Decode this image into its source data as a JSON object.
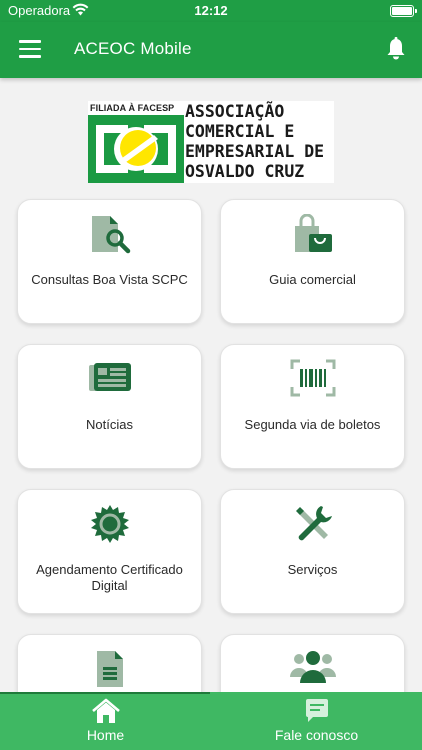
{
  "status_bar": {
    "carrier": "Operadora",
    "time": "12:12"
  },
  "app_bar": {
    "title": "ACEOC Mobile"
  },
  "logo": {
    "tag": "FILIADA À FACESP",
    "lines": [
      "ASSOCIAÇÃO",
      "COMERCIAL E",
      "EMPRESARIAL DE",
      "OSVALDO CRUZ"
    ]
  },
  "menu": [
    {
      "label": "Consultas Boa Vista SCPC",
      "icon": "document-search-icon"
    },
    {
      "label": "Guia comercial",
      "icon": "shopping-bag-icon"
    },
    {
      "label": "Notícias",
      "icon": "newspaper-icon"
    },
    {
      "label": "Segunda via de boletos",
      "icon": "barcode-scan-icon"
    },
    {
      "label": "Agendamento Certificado Digital",
      "icon": "certificate-seal-icon"
    },
    {
      "label": "Serviços",
      "icon": "tools-icon"
    },
    {
      "label": "",
      "icon": "document-icon"
    },
    {
      "label": "",
      "icon": "people-group-icon"
    }
  ],
  "bottom_nav": [
    {
      "label": "Home",
      "icon": "home-icon",
      "active": true
    },
    {
      "label": "Fale conosco",
      "icon": "chat-icon",
      "active": false
    }
  ],
  "colors": {
    "primary": "#1f9e45",
    "bottom_nav": "#3fb863",
    "icon": "#1f6b3c"
  }
}
